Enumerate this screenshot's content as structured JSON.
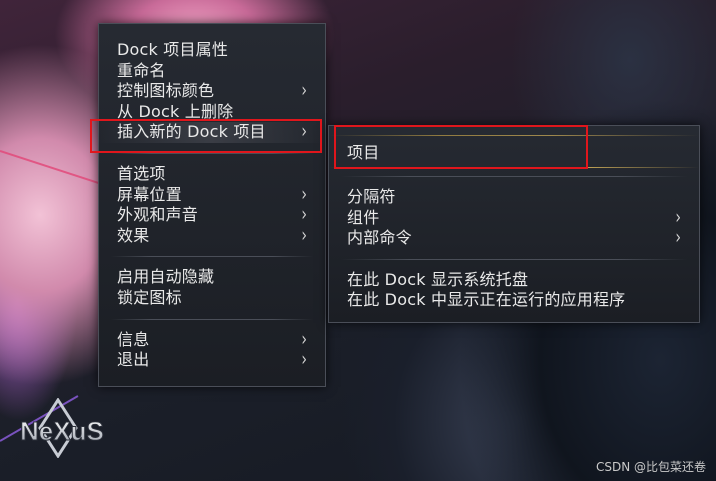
{
  "main_menu": {
    "groups": [
      [
        {
          "label": "Dock 项目属性",
          "submenu": false
        },
        {
          "label": "重命名",
          "submenu": false
        },
        {
          "label": "控制图标颜色",
          "submenu": true
        },
        {
          "label": "从 Dock 上删除",
          "submenu": false
        },
        {
          "label": "插入新的 Dock 项目",
          "submenu": true,
          "highlighted": true
        }
      ],
      [
        {
          "label": "首选项",
          "submenu": false
        },
        {
          "label": "屏幕位置",
          "submenu": true
        },
        {
          "label": "外观和声音",
          "submenu": true
        },
        {
          "label": "效果",
          "submenu": true
        }
      ],
      [
        {
          "label": "启用自动隐藏",
          "submenu": false
        },
        {
          "label": "锁定图标",
          "submenu": false
        }
      ],
      [
        {
          "label": "信息",
          "submenu": true
        },
        {
          "label": "退出",
          "submenu": true
        }
      ]
    ]
  },
  "sub_menu": {
    "groups": [
      [
        {
          "label": "项目",
          "submenu": false,
          "highlighted": true
        }
      ],
      [
        {
          "label": "分隔符",
          "submenu": false
        },
        {
          "label": "组件",
          "submenu": true
        },
        {
          "label": "内部命令",
          "submenu": true
        }
      ],
      [
        {
          "label": "在此 Dock 显示系统托盘",
          "submenu": false
        },
        {
          "label": "在此 Dock 中显示正在运行的应用程序",
          "submenu": false
        }
      ]
    ]
  },
  "logo_text": "NeXuS",
  "watermark": "CSDN @比包菜还卷",
  "arrow_glyph": "›",
  "colors": {
    "highlight_box": "#e0161c",
    "gold_accent": "#d8b14a",
    "menu_text": "#e9e9e9"
  }
}
